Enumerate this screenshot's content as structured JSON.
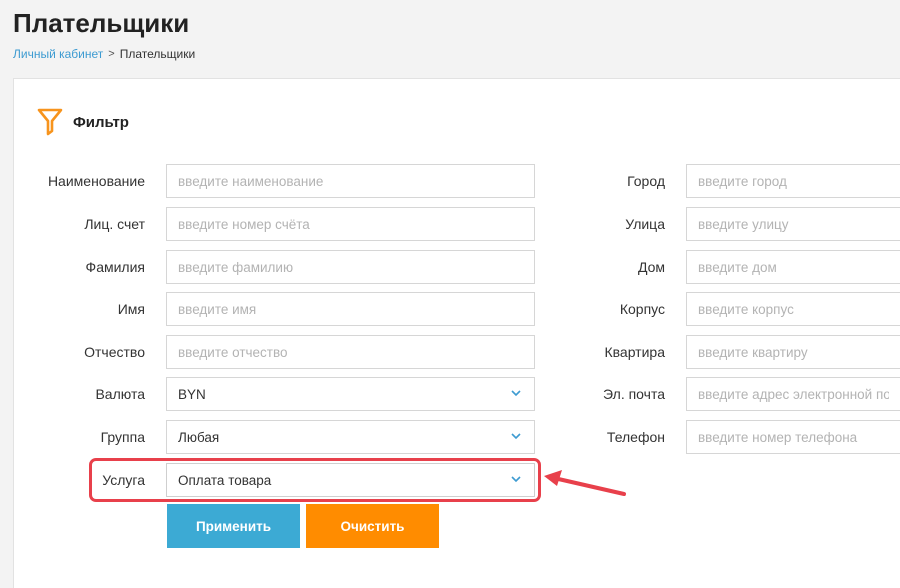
{
  "page": {
    "title": "Плательщики",
    "breadcrumb": {
      "home": "Личный кабинет",
      "separator": ">",
      "current": "Плательщики"
    }
  },
  "filter": {
    "title": "Фильтр",
    "icon": "filter-icon",
    "accent_color": "#f7941d",
    "left_fields": [
      {
        "label": "Наименование",
        "placeholder": "введите наименование"
      },
      {
        "label": "Лиц. счет",
        "placeholder": "введите номер счёта"
      },
      {
        "label": "Фамилия",
        "placeholder": "введите фамилию"
      },
      {
        "label": "Имя",
        "placeholder": "введите имя"
      },
      {
        "label": "Отчество",
        "placeholder": "введите отчество"
      }
    ],
    "selects": [
      {
        "label": "Валюта",
        "value": "BYN"
      },
      {
        "label": "Группа",
        "value": "Любая"
      },
      {
        "label": "Услуга",
        "value": "Оплата товара"
      }
    ],
    "right_fields": [
      {
        "label": "Город",
        "placeholder": "введите город"
      },
      {
        "label": "Улица",
        "placeholder": "введите улицу"
      },
      {
        "label": "Дом",
        "placeholder": "введите дом"
      },
      {
        "label": "Корпус",
        "placeholder": "введите корпус"
      },
      {
        "label": "Квартира",
        "placeholder": "введите квартиру"
      },
      {
        "label": "Эл. почта",
        "placeholder": "введите адрес электронной почты"
      },
      {
        "label": "Телефон",
        "placeholder": "введите номер телефона"
      }
    ],
    "buttons": {
      "apply": "Применить",
      "clear": "Очистить"
    },
    "apply_color": "#3caad4",
    "clear_color": "#ff8c00",
    "highlight_color": "#e8404b"
  }
}
